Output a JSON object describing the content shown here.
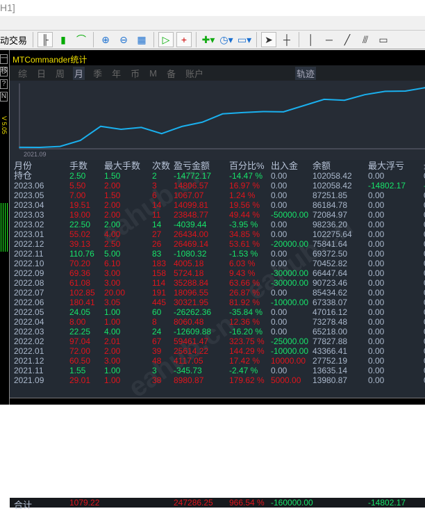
{
  "window_title": "H1]",
  "toolbar": {
    "auto_trade_label": "动交易"
  },
  "left_tools": [
    "一",
    "移",
    "?",
    "N"
  ],
  "version_label": "V 5.05",
  "panel": {
    "title": "MTCommander统计",
    "tabs": [
      "综",
      "日",
      "周",
      "月",
      "季",
      "年",
      "币",
      "M",
      "备",
      "账户"
    ],
    "active_tab": "月",
    "trajectory_tab": "轨迹"
  },
  "chart_data": {
    "type": "line",
    "x_label_start": "2021.09",
    "color": "#1ab0ee",
    "x": [
      "2021.09",
      "2021.11",
      "2021.12",
      "2022.01",
      "2022.02",
      "2022.03",
      "2022.04",
      "2022.05",
      "2022.06",
      "2022.07",
      "2022.08",
      "2022.09",
      "2022.10",
      "2022.11",
      "2022.12",
      "2023.01",
      "2023.02",
      "2023.03",
      "2023.04",
      "2023.05",
      "2023.06"
    ],
    "values": [
      8980.87,
      8635.14,
      12752.19,
      38366.41,
      97827.88,
      85218.0,
      93278.48,
      67016.12,
      97338.07,
      115434.62,
      150723.46,
      156447.64,
      160452.82,
      159372.5,
      185841.64,
      212275.64,
      208236.2,
      232084.97,
      246184.78,
      247251.85,
      262058.42
    ]
  },
  "columns": [
    "月份",
    "手数",
    "最大手数",
    "次数",
    "盈亏金额",
    "百分比%",
    "出入金",
    "余额",
    "最大浮亏",
    "最"
  ],
  "rows": [
    [
      "持仓",
      "2.50",
      "1.50",
      "2",
      "-14772.17",
      "-14.47 %",
      "0.00",
      "102058.42",
      "0.00"
    ],
    [
      "2023.06",
      "5.50",
      "2.00",
      "3",
      "14806.57",
      "16.97 %",
      "0.00",
      "102058.42",
      "-14802.17"
    ],
    [
      "2023.05",
      "7.00",
      "1.50",
      "6",
      "1067.07",
      "1.24 %",
      "0.00",
      "87251.85",
      "0.00"
    ],
    [
      "2023.04",
      "19.51",
      "2.00",
      "14",
      "14099.81",
      "19.56 %",
      "0.00",
      "86184.78",
      "0.00"
    ],
    [
      "2023.03",
      "19.00",
      "2.00",
      "11",
      "23848.77",
      "49.44 %",
      "-50000.00",
      "72084.97",
      "0.00"
    ],
    [
      "2023.02",
      "22.50",
      "2.00",
      "14",
      "-4039.44",
      "-3.95 %",
      "0.00",
      "98236.20",
      "0.00"
    ],
    [
      "2023.01",
      "55.02",
      "4.00",
      "27",
      "26434.00",
      "34.85 %",
      "0.00",
      "102275.64",
      "0.00"
    ],
    [
      "2022.12",
      "39.13",
      "2.50",
      "26",
      "26469.14",
      "53.61 %",
      "-20000.00",
      "75841.64",
      "0.00"
    ],
    [
      "2022.11",
      "110.76",
      "5.00",
      "83",
      "-1080.32",
      "-1.53 %",
      "0.00",
      "69372.50",
      "0.00"
    ],
    [
      "2022.10",
      "70.20",
      "6.10",
      "183",
      "4005.18",
      "6.03 %",
      "0.00",
      "70452.82",
      "0.00"
    ],
    [
      "2022.09",
      "69.36",
      "3.00",
      "158",
      "5724.18",
      "9.43 %",
      "-30000.00",
      "66447.64",
      "0.00"
    ],
    [
      "2022.08",
      "61.08",
      "3.00",
      "114",
      "35288.84",
      "63.66 %",
      "-30000.00",
      "90723.46",
      "0.00"
    ],
    [
      "2022.07",
      "102.85",
      "20.00",
      "191",
      "18096.55",
      "26.87 %",
      "0.00",
      "85434.62",
      "0.00"
    ],
    [
      "2022.06",
      "180.41",
      "3.05",
      "445",
      "30321.95",
      "81.92 %",
      "-10000.00",
      "67338.07",
      "0.00"
    ],
    [
      "2022.05",
      "24.05",
      "1.00",
      "60",
      "-26262.36",
      "-35.84 %",
      "0.00",
      "47016.12",
      "0.00"
    ],
    [
      "2022.04",
      "8.00",
      "1.00",
      "8",
      "8060.48",
      "12.36 %",
      "0.00",
      "73278.48",
      "0.00"
    ],
    [
      "2022.03",
      "22.25",
      "4.00",
      "24",
      "-12609.88",
      "-16.20 %",
      "0.00",
      "65218.00",
      "0.00"
    ],
    [
      "2022.02",
      "97.04",
      "2.01",
      "67",
      "59461.47",
      "323.75 %",
      "-25000.00",
      "77827.88",
      "0.00"
    ],
    [
      "2022.01",
      "72.00",
      "2.00",
      "39",
      "25614.22",
      "144.29 %",
      "-10000.00",
      "43366.41",
      "0.00"
    ],
    [
      "2021.12",
      "60.50",
      "3.00",
      "48",
      "4117.05",
      "17.42 %",
      "10000.00",
      "27752.19",
      "0.00"
    ],
    [
      "2021.11",
      "1.55",
      "1.00",
      "3",
      "-345.73",
      "-2.47 %",
      "0.00",
      "13635.14",
      "0.00"
    ],
    [
      "2021.09",
      "29.01",
      "1.00",
      "38",
      "8980.87",
      "179.62 %",
      "5000.00",
      "13980.87",
      "0.00"
    ]
  ],
  "total": {
    "label": "合计",
    "lots": "1079.22",
    "profit": "247286.25",
    "percent": "966.54 %",
    "deposit": "-160000.00",
    "max_float_loss": "-14802.17"
  },
  "watermark": "eahub.cn",
  "colors": {
    "profit": "#e0141c",
    "loss": "#17e36a",
    "neutral": "#aab8cc"
  }
}
